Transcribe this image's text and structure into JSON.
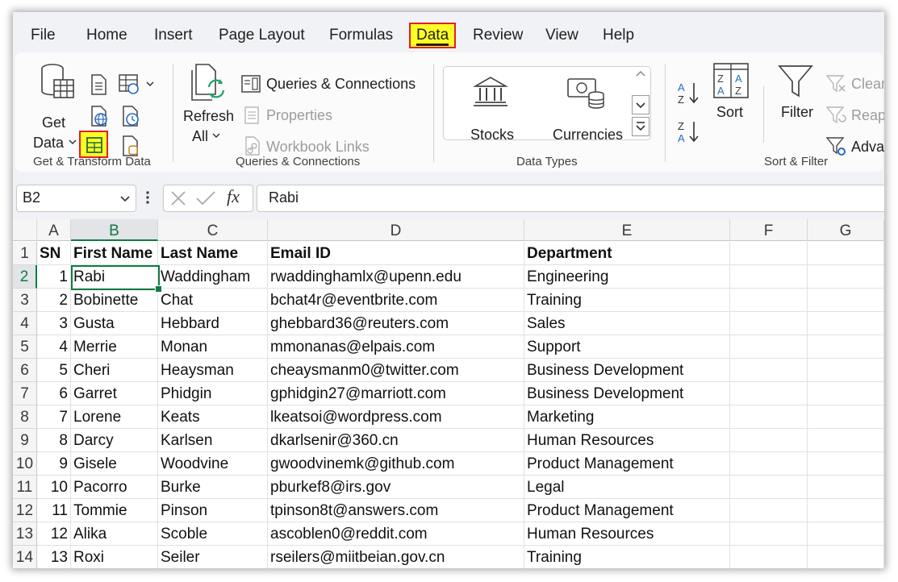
{
  "menu": [
    "File",
    "Home",
    "Insert",
    "Page Layout",
    "Formulas",
    "Data",
    "Review",
    "View",
    "Help"
  ],
  "ribbon": {
    "get_data": {
      "line1": "Get",
      "line2": "Data"
    },
    "refresh_all": {
      "line1": "Refresh",
      "line2": "All"
    },
    "queries_connections": "Queries & Connections",
    "properties": "Properties",
    "workbook_links": "Workbook Links",
    "stocks": "Stocks",
    "currencies": "Currencies",
    "sort": "Sort",
    "filter": "Filter",
    "clear": "Clear",
    "reapply": "Reapply",
    "advanced": "Advanced",
    "groups": [
      "Get & Transform Data",
      "Queries & Connections",
      "Data Types",
      "Sort & Filter"
    ]
  },
  "formula_bar": {
    "name_box": "B2",
    "fx": "fx",
    "value": "Rabi"
  },
  "columns": [
    "A",
    "B",
    "C",
    "D",
    "E",
    "F",
    "G"
  ],
  "rows": [
    [
      "SN",
      "First Name",
      "Last Name",
      "Email ID",
      "Department"
    ],
    [
      "1",
      "Rabi",
      "Waddingham",
      "rwaddinghamlx@upenn.edu",
      "Engineering"
    ],
    [
      "2",
      "Bobinette",
      "Chat",
      "bchat4r@eventbrite.com",
      "Training"
    ],
    [
      "3",
      "Gusta",
      "Hebbard",
      "ghebbard36@reuters.com",
      "Sales"
    ],
    [
      "4",
      "Merrie",
      "Monan",
      "mmonanas@elpais.com",
      "Support"
    ],
    [
      "5",
      "Cheri",
      "Heaysman",
      "cheaysmanm0@twitter.com",
      "Business Development"
    ],
    [
      "6",
      "Garret",
      "Phidgin",
      "gphidgin27@marriott.com",
      "Business Development"
    ],
    [
      "7",
      "Lorene",
      "Keats",
      "lkeatsoi@wordpress.com",
      "Marketing"
    ],
    [
      "8",
      "Darcy",
      "Karlsen",
      "dkarlsenir@360.cn",
      "Human Resources"
    ],
    [
      "9",
      "Gisele",
      "Woodvine",
      "gwoodvinemk@github.com",
      "Product Management"
    ],
    [
      "10",
      "Pacorro",
      "Burke",
      "pburkef8@irs.gov",
      "Legal"
    ],
    [
      "11",
      "Tommie",
      "Pinson",
      "tpinson8t@answers.com",
      "Product Management"
    ],
    [
      "12",
      "Alika",
      "Scoble",
      "ascoblen0@reddit.com",
      "Human Resources"
    ],
    [
      "13",
      "Roxi",
      "Seiler",
      "rseilers@miitbeian.gov.cn",
      "Training"
    ]
  ],
  "row_numbers": [
    "1",
    "2",
    "3",
    "4",
    "5",
    "6",
    "7",
    "8",
    "9",
    "10",
    "11",
    "12",
    "13",
    "14"
  ],
  "colors": {
    "highlight": "#ffff26",
    "highlight_border": "#e0202a",
    "excel_green": "#107c41"
  }
}
